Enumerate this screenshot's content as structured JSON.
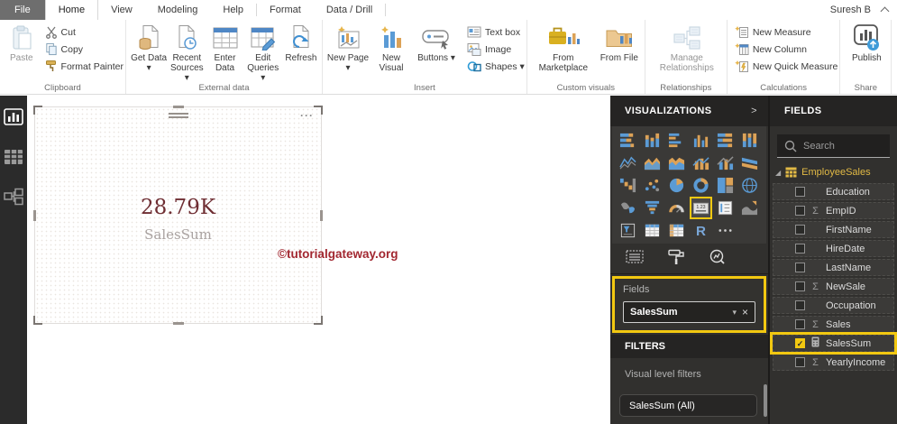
{
  "colors": {
    "accent": "#F2C811",
    "card_value": "#6F2E33",
    "watermark": "#A22730",
    "table_name": "#E2BA45",
    "panel_bg": "#31302E"
  },
  "tabs": {
    "items": [
      "File",
      "Home",
      "View",
      "Modeling",
      "Help",
      "Format",
      "Data / Drill"
    ],
    "active": "Home",
    "user": "Suresh B"
  },
  "ribbon": {
    "clipboard": {
      "label": "Clipboard",
      "paste": "Paste",
      "cut": "Cut",
      "copy": "Copy",
      "format_painter": "Format Painter"
    },
    "external_data": {
      "label": "External data",
      "get_data": "Get Data ▾",
      "recent_sources": "Recent Sources ▾",
      "enter_data": "Enter Data",
      "edit_queries": "Edit Queries ▾",
      "refresh": "Refresh"
    },
    "insert": {
      "label": "Insert",
      "new_page": "New Page ▾",
      "new_visual": "New Visual",
      "buttons": "Buttons ▾",
      "text_box": "Text box",
      "image": "Image",
      "shapes": "Shapes ▾"
    },
    "custom_visuals": {
      "label": "Custom visuals",
      "from_marketplace": "From Marketplace",
      "from_file": "From File"
    },
    "relationships": {
      "label": "Relationships",
      "manage_relationships": "Manage Relationships"
    },
    "calculations": {
      "label": "Calculations",
      "new_measure": "New Measure",
      "new_column": "New Column",
      "new_quick_measure": "New Quick Measure"
    },
    "share": {
      "label": "Share",
      "publish": "Publish"
    }
  },
  "canvas": {
    "card": {
      "value": "28.79K",
      "label": "SalesSum",
      "more": "···"
    },
    "watermark": "©tutorialgateway.org"
  },
  "visualizations": {
    "title": "VISUALIZATIONS",
    "collapse": ">",
    "icons": [
      {
        "name": "stacked-bar"
      },
      {
        "name": "stacked-column"
      },
      {
        "name": "clustered-bar"
      },
      {
        "name": "clustered-column"
      },
      {
        "name": "stacked-bar-100"
      },
      {
        "name": "stacked-column-100"
      },
      {
        "name": "line"
      },
      {
        "name": "area"
      },
      {
        "name": "stacked-area"
      },
      {
        "name": "line-stacked-column"
      },
      {
        "name": "line-clustered-column"
      },
      {
        "name": "ribbon-chart"
      },
      {
        "name": "waterfall"
      },
      {
        "name": "scatter"
      },
      {
        "name": "pie"
      },
      {
        "name": "donut"
      },
      {
        "name": "treemap"
      },
      {
        "name": "map"
      },
      {
        "name": "filled-map"
      },
      {
        "name": "funnel"
      },
      {
        "name": "gauge"
      },
      {
        "name": "card",
        "selected": true
      },
      {
        "name": "multi-row-card"
      },
      {
        "name": "kpi"
      },
      {
        "name": "slicer"
      },
      {
        "name": "table"
      },
      {
        "name": "matrix"
      },
      {
        "name": "r-script"
      },
      {
        "name": "more"
      }
    ],
    "fields_section": {
      "label": "Fields",
      "well_value": "SalesSum",
      "dropdown": "▾",
      "remove": "×"
    },
    "filters": {
      "title": "FILTERS",
      "section": "Visual level filters",
      "pill": "SalesSum (All)"
    }
  },
  "fields_panel": {
    "title": "FIELDS",
    "search_placeholder": "Search",
    "table_name": "EmployeeSales",
    "items": [
      {
        "label": "Education"
      },
      {
        "label": "EmpID",
        "sigma": true
      },
      {
        "label": "FirstName"
      },
      {
        "label": "HireDate"
      },
      {
        "label": "LastName"
      },
      {
        "label": "NewSale",
        "sigma": true
      },
      {
        "label": "Occupation"
      },
      {
        "label": "Sales",
        "sigma": true
      },
      {
        "label": "SalesSum",
        "calc": true,
        "checked": true,
        "highlighted": true
      },
      {
        "label": "YearlyIncome",
        "sigma": true
      }
    ]
  }
}
